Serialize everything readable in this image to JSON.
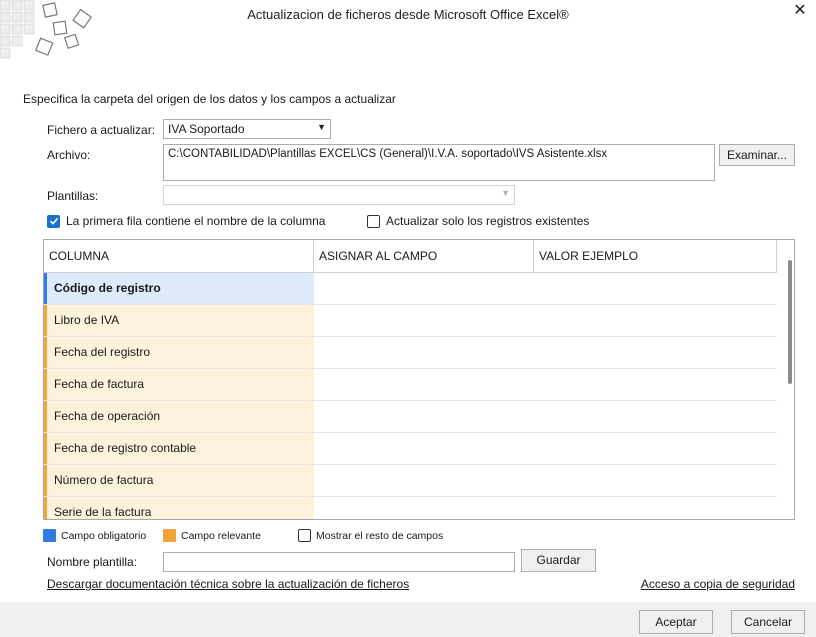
{
  "window": {
    "title": "Actualizacion de ficheros desde Microsoft Office Excel®",
    "close_glyph": "✕"
  },
  "section_title": "Especifica la carpeta del origen de los datos y los campos a actualizar",
  "form": {
    "fichero_label": "Fichero a actualizar:",
    "fichero_value": "IVA Soportado",
    "archivo_label": "Archivo:",
    "archivo_value": "C:\\CONTABILIDAD\\Plantillas EXCEL\\CS (General)\\I.V.A. soportado\\IVS Asistente.xlsx",
    "examinar_label": "Examinar...",
    "plantillas_label": "Plantillas:",
    "plantillas_value": ""
  },
  "options": {
    "primera_fila": {
      "label": "La primera fila contiene el nombre de la columna",
      "checked": true
    },
    "solo_existentes": {
      "label": "Actualizar solo los registros existentes",
      "checked": false
    }
  },
  "grid": {
    "columns": [
      "COLUMNA",
      "ASIGNAR AL CAMPO",
      "VALOR EJEMPLO"
    ],
    "rows": [
      {
        "name": "Código de registro",
        "kind": "obligatorio"
      },
      {
        "name": "Libro de IVA",
        "kind": "relevante"
      },
      {
        "name": "Fecha del registro",
        "kind": "relevante"
      },
      {
        "name": "Fecha de factura",
        "kind": "relevante"
      },
      {
        "name": "Fecha de operación",
        "kind": "relevante"
      },
      {
        "name": "Fecha de registro contable",
        "kind": "relevante"
      },
      {
        "name": "Número de factura",
        "kind": "relevante"
      },
      {
        "name": "Serie de la factura",
        "kind": "relevante"
      }
    ]
  },
  "legend": {
    "obligatorio": {
      "label": "Campo obligatorio",
      "color": "#2f7ae5"
    },
    "relevante": {
      "label": "Campo relevante",
      "color": "#f2a33a"
    },
    "mostrar_resto": {
      "label": "Mostrar el resto de campos",
      "checked": false
    }
  },
  "plantilla": {
    "label": "Nombre plantilla:",
    "value": "",
    "guardar_label": "Guardar"
  },
  "links": {
    "documentacion": "Descargar documentación técnica sobre la actualización de ficheros",
    "copia_seguridad": "Acceso a copia de seguridad"
  },
  "footer": {
    "aceptar": "Aceptar",
    "cancelar": "Cancelar"
  }
}
